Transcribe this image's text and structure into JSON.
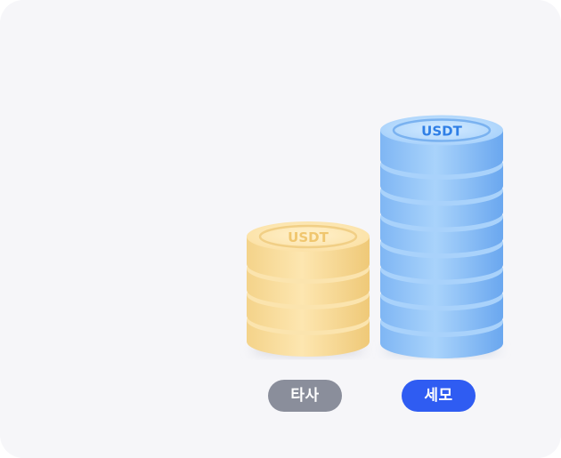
{
  "comparison": {
    "competitor": {
      "label": "타사",
      "coin_text": "USDT",
      "coin_count": 4,
      "badge_color": "#8a8e9b",
      "coin_color": "#fbe0a3"
    },
    "semo": {
      "label": "세모",
      "coin_text": "USDT",
      "coin_count": 8,
      "badge_color": "#2f5cf2",
      "coin_color": "#9ccbfa"
    }
  }
}
